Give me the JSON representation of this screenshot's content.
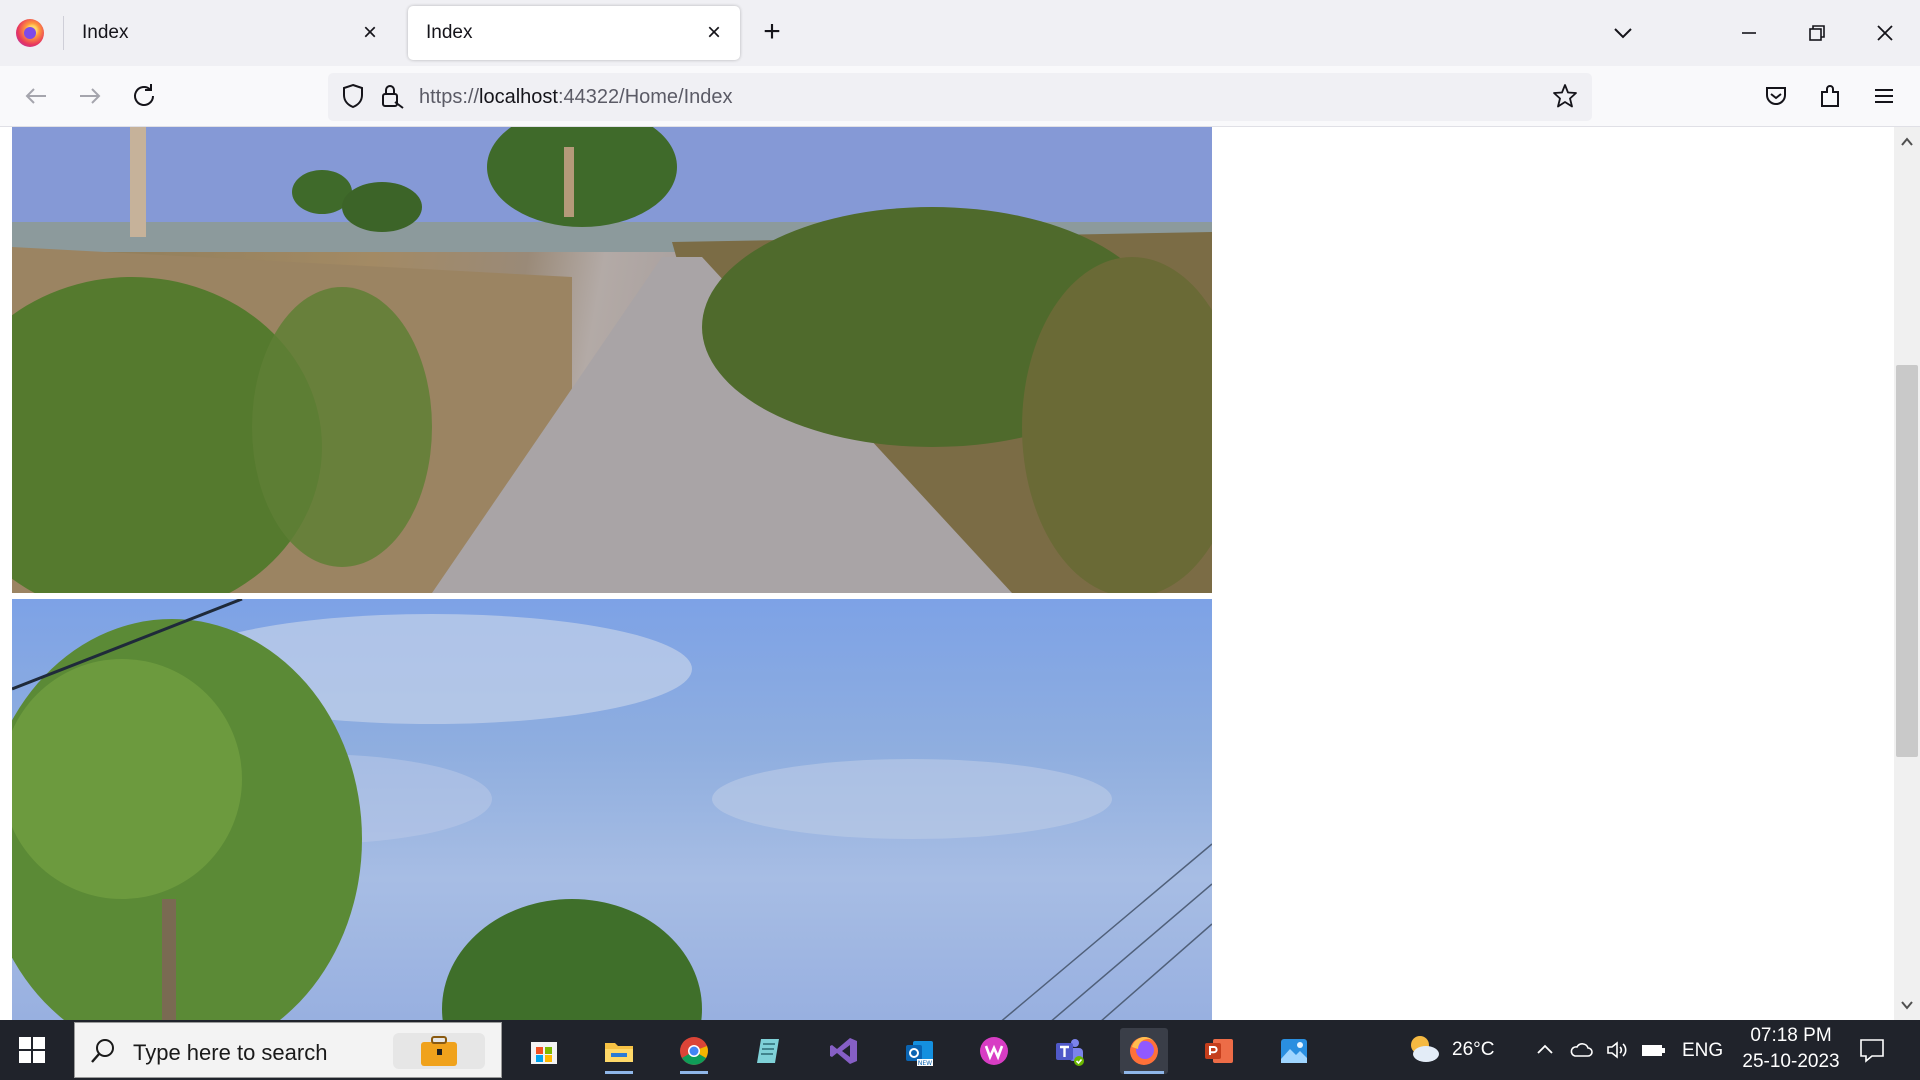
{
  "browser": {
    "tabs": [
      {
        "title": "Index",
        "active": false
      },
      {
        "title": "Index",
        "active": true
      }
    ],
    "url": {
      "prefix": "https://",
      "host": "localhost",
      "rest": ":44322/Home/Index"
    }
  },
  "page": {
    "images": [
      {
        "subject": "rural concrete road with dry grass and shrubs"
      },
      {
        "subject": "trees against blue cloudy sky"
      }
    ],
    "scroll_position_fraction": 0.28
  },
  "taskbar": {
    "search_placeholder": "Type here to search",
    "apps": [
      "File Explorer",
      "Microsoft Store",
      "Google Chrome",
      "Notepad",
      "Visual Studio",
      "Outlook (new)",
      "WPS Office",
      "Microsoft Teams",
      "Firefox",
      "PowerPoint",
      "Photos"
    ],
    "weather": {
      "temp": "26°C"
    },
    "language": "ENG",
    "time": "07:18 PM",
    "date": "25-10-2023"
  },
  "colors": {
    "accent": "#0060df",
    "taskbar": "#20232b",
    "tabstrip": "#f0f0f4"
  }
}
